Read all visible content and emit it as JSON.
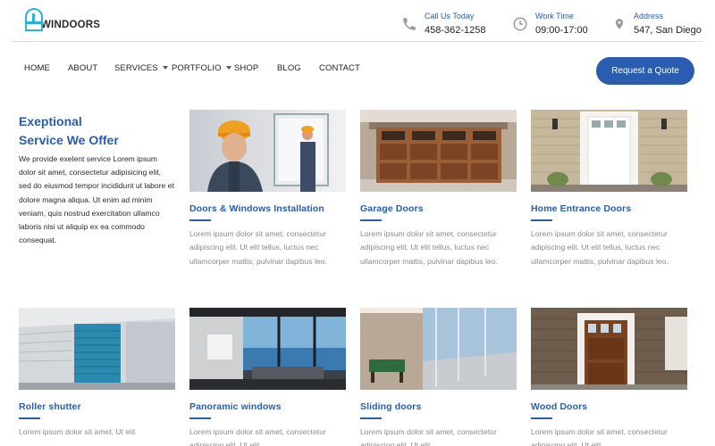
{
  "brand": {
    "name": "WINDOORS"
  },
  "contact": {
    "phone": {
      "label": "Call Us Today",
      "value": "458-362-1258",
      "icon": "phone-icon"
    },
    "hours": {
      "label": "Work Time",
      "value": "09:00-17:00",
      "icon": "clock-icon"
    },
    "address": {
      "label": "Address",
      "value": "547, San Diego",
      "icon": "map-pin-icon"
    }
  },
  "nav": {
    "items": [
      "HOME",
      "ABOUT",
      "SERVICES",
      "PORTFOLIO",
      "SHOP",
      "BLOG",
      "CONTACT"
    ],
    "cta": "Request a Quote"
  },
  "intro": {
    "title_line1": "Exeptional",
    "title_line2": "Service We Offer",
    "text": "We provide exelent service Lorem ipsum dolor sit amet, consectetur adipisicing elit, sed do eiusmod tempor incididunt ut labore et dolore magna aliqua. Ut enim ad minim veniam, quis nostrud exercitation ullamco laboris nisi ut aliquip ex ea commodo consequat."
  },
  "services": [
    {
      "title": "Doors & Windows Installation",
      "text": "Lorem ipsum dolor sit amet, consectetur adipiscing elit. Ut elit tellus, luctus nec ullamcorper mattis, pulvinar dapibus leo."
    },
    {
      "title": "Garage Doors",
      "text": "Lorem ipsum dolor sit amet, consectetur adipiscing elit. Ut elit tellus, luctus nec ullamcorper mattis, pulvinar dapibus leo."
    },
    {
      "title": "Home Entrance Doors",
      "text": "Lorem ipsum dolor sit amet, consectetur adipiscing elit. Ut elit tellus, luctus nec ullamcorper mattis, pulvinar dapibus leo."
    },
    {
      "title": "Roller shutter",
      "text": "Lorem ipsum dolor sit amet, Ut elit"
    },
    {
      "title": "Panoramic windows",
      "text": "Lorem ipsum dolor sit amet, consectetur adipiscing elit. Ut elit"
    },
    {
      "title": "Sliding doors",
      "text": "Lorem ipsum dolor sit amet, consectetur adipiscing elit. Ut elit"
    },
    {
      "title": "Wood Doors",
      "text": "Lorem ipsum dolor sit amet, consectetur adipiscing elit. Ut elit"
    }
  ],
  "colors": {
    "accent": "#2a5db0",
    "logo": "#28b4d4"
  }
}
